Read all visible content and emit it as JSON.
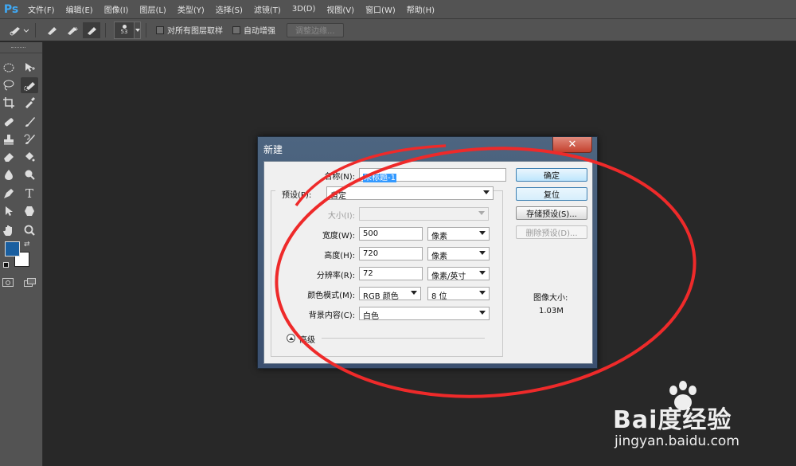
{
  "app": {
    "logo": "Ps"
  },
  "menu": [
    "文件(F)",
    "编辑(E)",
    "图像(I)",
    "图层(L)",
    "类型(Y)",
    "选择(S)",
    "滤镜(T)",
    "3D(D)",
    "视图(V)",
    "窗口(W)",
    "帮助(H)"
  ],
  "options_bar": {
    "brush_size": "53",
    "sample_all_layers_label": "对所有图层取样",
    "auto_enhance_label": "自动增强",
    "refine_edge_button": "调整边缘..."
  },
  "toolbar": {
    "tools": [
      "ellipse-marquee-icon",
      "move-icon",
      "lasso-icon",
      "quick-selection-icon",
      "crop-icon",
      "eyedropper-icon",
      "spot-healing-icon",
      "brush-icon",
      "clone-stamp-icon",
      "history-brush-icon",
      "eraser-icon",
      "paint-bucket-icon",
      "blur-icon",
      "dodge-icon",
      "pen-icon",
      "type-icon",
      "path-selection-icon",
      "shape-icon",
      "hand-icon",
      "zoom-icon"
    ],
    "foreground_color": "#1a5fa0",
    "background_color": "#ffffff"
  },
  "dialog": {
    "title": "新建",
    "close_glyph": "✕",
    "name_label": "名称(N):",
    "name_value": "未标题-1",
    "preset_label": "预设(P):",
    "preset_value": "自定",
    "size_label": "大小(I):",
    "size_value": "",
    "width_label": "宽度(W):",
    "width_value": "500",
    "width_unit": "像素",
    "height_label": "高度(H):",
    "height_value": "720",
    "height_unit": "像素",
    "resolution_label": "分辨率(R):",
    "resolution_value": "72",
    "resolution_unit": "像素/英寸",
    "color_mode_label": "颜色模式(M):",
    "color_mode_value": "RGB 颜色",
    "bit_depth_value": "8 位",
    "background_label": "背景内容(C):",
    "background_value": "白色",
    "advanced_label": "高级",
    "ok_button": "确定",
    "reset_button": "复位",
    "save_preset_button": "存储预设(S)...",
    "delete_preset_button": "删除预设(D)...",
    "image_size_label": "图像大小:",
    "image_size_value": "1.03M"
  },
  "annotation": {
    "color": "#ee2a2a"
  },
  "watermark": {
    "brand": "Bai度经验",
    "url": "jingyan.baidu.com"
  }
}
